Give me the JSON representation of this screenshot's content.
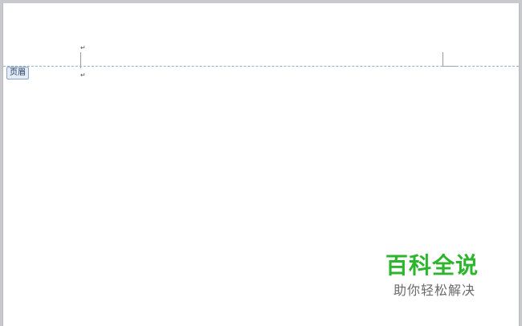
{
  "document": {
    "paragraph_mark": "↵",
    "header_tab_label": "页眉"
  },
  "watermark": {
    "title": "百科全说",
    "subtitle": "助你轻松解决"
  },
  "colors": {
    "watermark_title": "#2db52d",
    "watermark_subtitle": "#6a6a6a",
    "header_line": "#8fb2d0",
    "page": "#ffffff"
  }
}
